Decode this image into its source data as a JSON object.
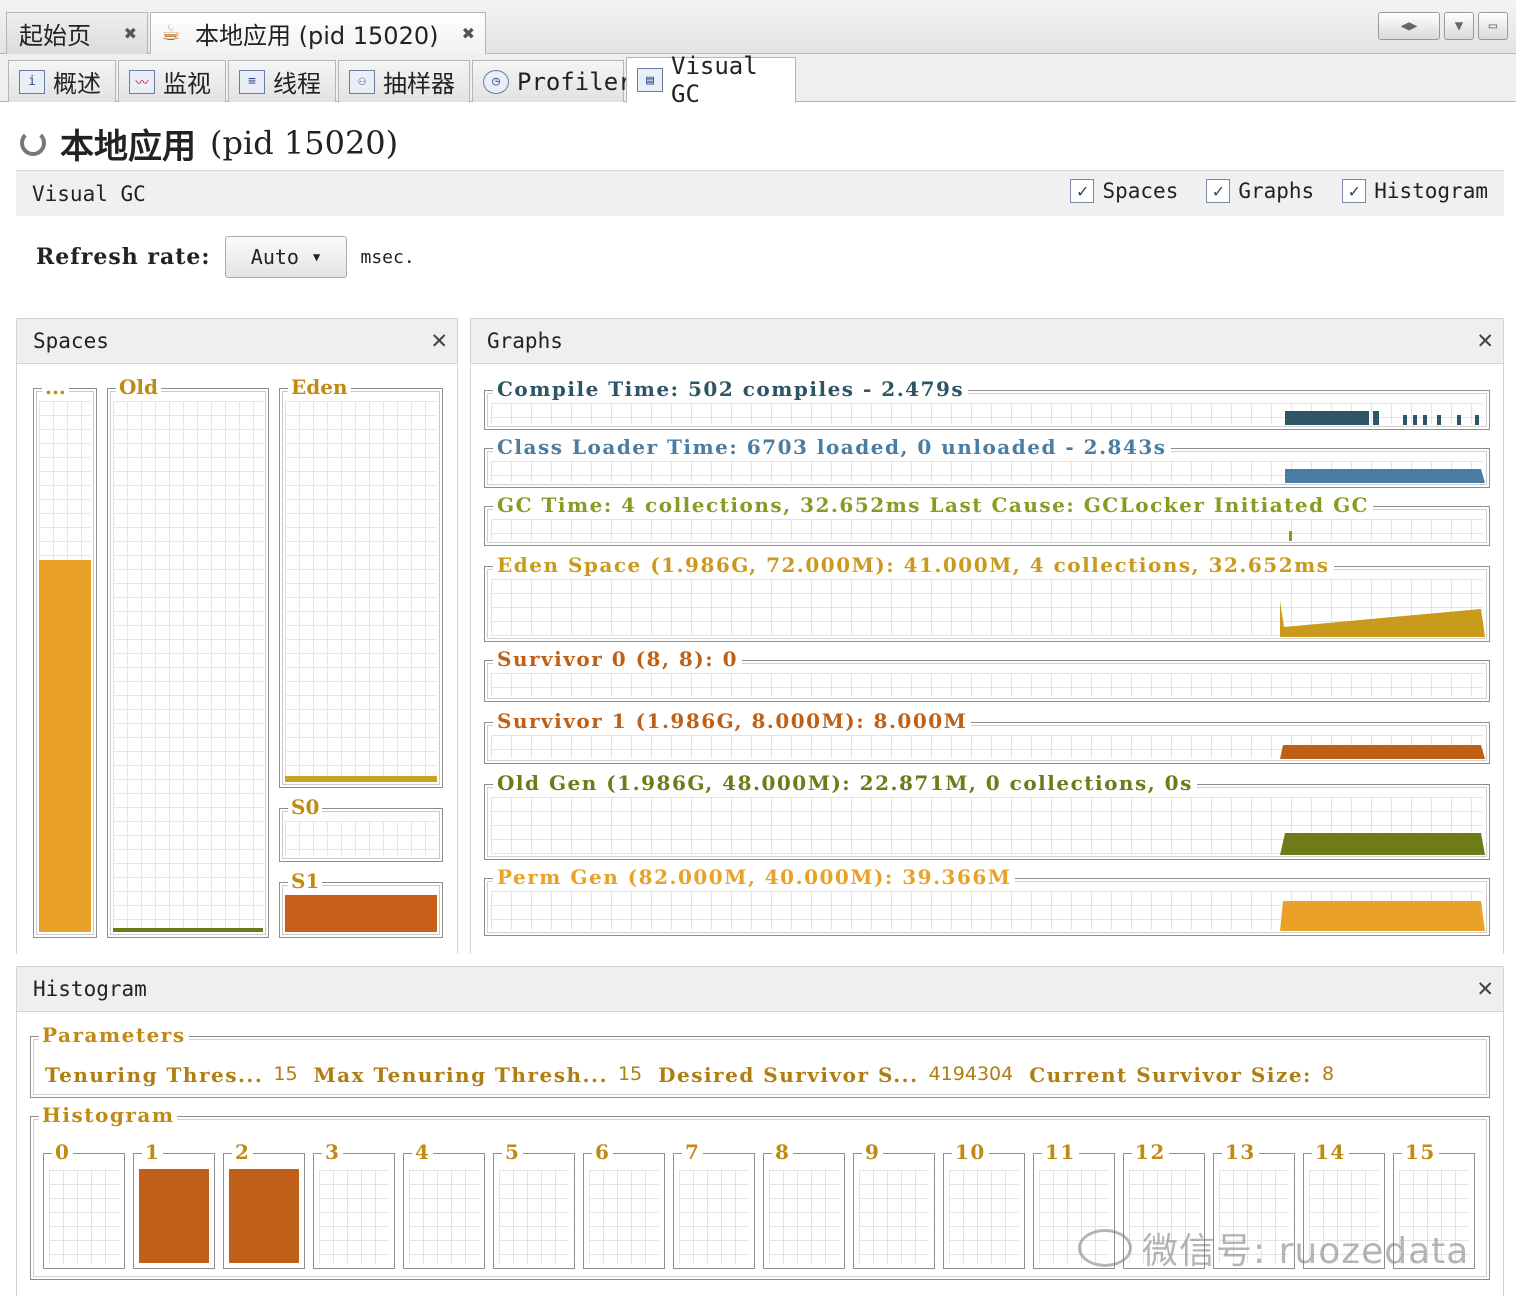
{
  "doc_tabs": [
    {
      "label": "起始页",
      "close": "✖"
    },
    {
      "label": "本地应用 (pid 15020)",
      "close": "✖"
    }
  ],
  "window_controls": [
    "◀▶",
    "▼",
    "▭"
  ],
  "view_tabs": [
    {
      "label": "概述",
      "icon": "overview-icon"
    },
    {
      "label": "监视",
      "icon": "monitor-icon"
    },
    {
      "label": "线程",
      "icon": "threads-icon"
    },
    {
      "label": "抽样器",
      "icon": "sampler-icon"
    },
    {
      "label": "Profiler",
      "icon": "profiler-icon"
    },
    {
      "label": "Visual GC",
      "icon": "visualgc-icon"
    }
  ],
  "page_title": {
    "main": "本地应用",
    "pid": "(pid 15020)"
  },
  "visual_gc": {
    "title": "Visual GC",
    "checks": [
      {
        "label": "Spaces",
        "checked": true
      },
      {
        "label": "Graphs",
        "checked": true
      },
      {
        "label": "Histogram",
        "checked": true
      }
    ]
  },
  "refresh": {
    "label": "Refresh rate:",
    "value": "Auto",
    "unit": "msec."
  },
  "spaces": {
    "title": "Spaces",
    "close": "✕",
    "items": [
      {
        "label": "...",
        "fill_fraction": 0.7,
        "color": "#e9a227"
      },
      {
        "label": "Old",
        "fill_fraction": 0.008,
        "color": "#6d7a1a"
      },
      {
        "label": "Eden",
        "fill_fraction": 0.015,
        "color": "#c9a21f"
      },
      {
        "label": "S0",
        "fill_fraction": 0,
        "color": "#c65f17"
      },
      {
        "label": "S1",
        "fill_fraction": 1.0,
        "color": "#c65f17"
      }
    ]
  },
  "graphs": {
    "title": "Graphs",
    "close": "✕",
    "rows": [
      {
        "label": "Compile Time: 502 compiles - 2.479s",
        "color": "#2e5565"
      },
      {
        "label": "Class Loader Time: 6703 loaded, 0 unloaded - 2.843s",
        "color": "#4a7da3"
      },
      {
        "label": "GC Time: 4 collections, 32.652ms Last Cause: GCLocker Initiated GC",
        "color": "#8a9a22"
      },
      {
        "label": "Eden Space (1.986G, 72.000M): 41.000M, 4 collections, 32.652ms",
        "color": "#c99a1c"
      },
      {
        "label": "Survivor 0 (8, 8): 0",
        "color": "#c06017"
      },
      {
        "label": "Survivor 1 (1.986G, 8.000M): 8.000M",
        "color": "#c06017"
      },
      {
        "label": "Old Gen (1.986G, 48.000M): 22.871M, 0 collections, 0s",
        "color": "#6f7a18"
      },
      {
        "label": "Perm Gen (82.000M, 40.000M): 39.366M",
        "color": "#e9a227"
      }
    ]
  },
  "histogram": {
    "title": "Histogram",
    "close": "✕",
    "parameters_title": "Parameters",
    "parameters": [
      {
        "name": "Tenuring Thres...",
        "value": "15"
      },
      {
        "name": "Max Tenuring Thresh...",
        "value": "15"
      },
      {
        "name": "Desired Survivor S...",
        "value": "4194304"
      },
      {
        "name": "Current Survivor Size:",
        "value": "8"
      }
    ],
    "histogram_title": "Histogram",
    "ages": [
      {
        "label": "0",
        "fill": 0
      },
      {
        "label": "1",
        "fill": 1
      },
      {
        "label": "2",
        "fill": 1
      },
      {
        "label": "3",
        "fill": 0
      },
      {
        "label": "4",
        "fill": 0
      },
      {
        "label": "5",
        "fill": 0
      },
      {
        "label": "6",
        "fill": 0
      },
      {
        "label": "7",
        "fill": 0
      },
      {
        "label": "8",
        "fill": 0
      },
      {
        "label": "9",
        "fill": 0
      },
      {
        "label": "10",
        "fill": 0
      },
      {
        "label": "11",
        "fill": 0
      },
      {
        "label": "12",
        "fill": 0
      },
      {
        "label": "13",
        "fill": 0
      },
      {
        "label": "14",
        "fill": 0
      },
      {
        "label": "15",
        "fill": 0
      }
    ],
    "bar_color": "#c05f17"
  },
  "watermark": "微信号: ruozedata"
}
